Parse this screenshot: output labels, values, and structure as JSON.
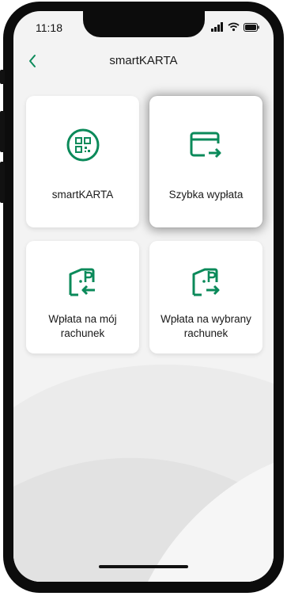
{
  "status_bar": {
    "time": "11:18"
  },
  "header": {
    "title": "smartKARTA"
  },
  "tiles": [
    {
      "label": "smartKARTA",
      "icon": "qr-code-icon"
    },
    {
      "label": "Szybka wypłata",
      "icon": "card-withdraw-icon",
      "selected": true
    },
    {
      "label": "Wpłata na mój rachunek",
      "icon": "atm-deposit-own-icon"
    },
    {
      "label": "Wpłata na wybrany rachunek",
      "icon": "atm-deposit-other-icon"
    }
  ],
  "colors": {
    "accent": "#0b8a5a",
    "background": "#f3f3f3",
    "tile": "#ffffff"
  }
}
